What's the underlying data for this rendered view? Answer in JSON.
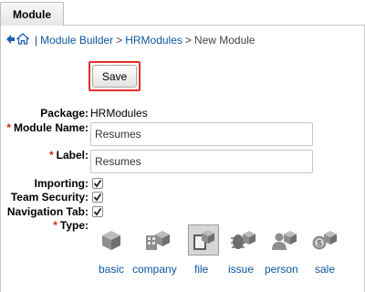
{
  "tab": {
    "label": "Module"
  },
  "breadcrumb": {
    "separator": "|",
    "items": [
      "Module Builder",
      "HRModules",
      "New Module"
    ],
    "arrow": ">"
  },
  "toolbar": {
    "save_label": "Save"
  },
  "form": {
    "package_label": "Package:",
    "package_value": "HRModules",
    "module_name_label": "Module Name:",
    "module_name_value": "Resumes",
    "label_label": "Label:",
    "label_value": "Resumes",
    "importing_label": "Importing:",
    "importing_checked": true,
    "team_security_label": "Team Security:",
    "team_security_checked": true,
    "navigation_tab_label": "Navigation Tab:",
    "navigation_tab_checked": true,
    "required_marker": "*",
    "type_label": "Type:",
    "types": [
      {
        "label": "basic",
        "icon": "cube-icon",
        "selected": false
      },
      {
        "label": "company",
        "icon": "company-icon",
        "selected": false
      },
      {
        "label": "file",
        "icon": "file-icon",
        "selected": true
      },
      {
        "label": "issue",
        "icon": "issue-icon",
        "selected": false
      },
      {
        "label": "person",
        "icon": "person-icon",
        "selected": false
      },
      {
        "label": "sale",
        "icon": "sale-icon",
        "selected": false
      }
    ]
  },
  "colors": {
    "link": "#0b57a2",
    "required": "#d0251b",
    "highlight": "#e0302a"
  }
}
